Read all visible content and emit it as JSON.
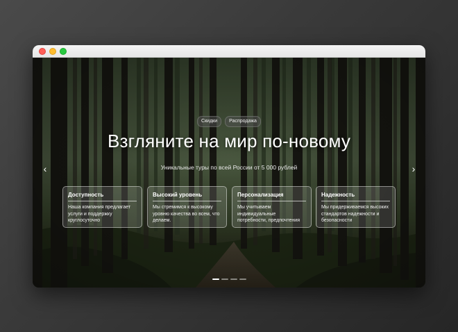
{
  "window": {
    "controls": [
      "close",
      "minimize",
      "zoom"
    ]
  },
  "hero": {
    "tags": [
      "Скидки",
      "Распродажа"
    ],
    "title": "Взгляните на мир по-новому",
    "subtitle": "Уникальные туры по всей России от 5 000 рублей",
    "prev_icon": "chevron-left-icon",
    "next_icon": "chevron-right-icon",
    "prev_glyph": "‹",
    "next_glyph": "›"
  },
  "cards": [
    {
      "title": "Доступность",
      "text": "Наша компания предлагает услуги и поддержку круглосуточно"
    },
    {
      "title": "Высокий уровень",
      "text": "Мы стремимся к высокому уровню качества во всем, что делаем."
    },
    {
      "title": "Персонализация",
      "text": "Мы учитываем индивидуальные потребности, предпочтения"
    },
    {
      "title": "Надежность",
      "text": "Мы придерживаемся высоких стандартов надежности и безопасности"
    }
  ],
  "pagination": {
    "total": 4,
    "active_index": 0
  },
  "colors": {
    "close": "#fe5f57",
    "minimize": "#febc2e",
    "zoom": "#28c840",
    "background": "#3a3a3a"
  }
}
